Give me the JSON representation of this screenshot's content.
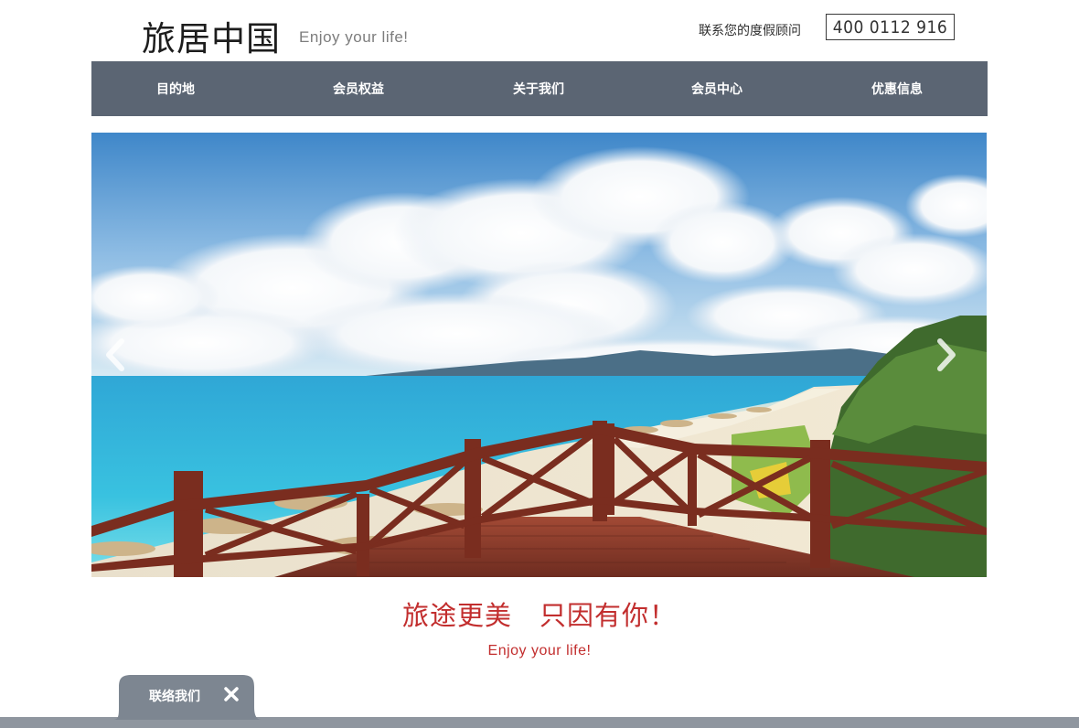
{
  "header": {
    "logo_cn": "旅居中国",
    "logo_en": "Enjoy your life!",
    "contact_label": "联系您的度假顾问",
    "phone": "400 0112 916"
  },
  "nav": {
    "items": [
      {
        "label": "目的地"
      },
      {
        "label": "会员权益"
      },
      {
        "label": "关于我们"
      },
      {
        "label": "会员中心"
      },
      {
        "label": "优惠信息"
      }
    ]
  },
  "hero": {
    "prev_icon": "chevron-left-icon",
    "next_icon": "chevron-right-icon"
  },
  "slogan": {
    "cn": "旅途更美　只因有你！",
    "en": "Enjoy your life!"
  },
  "contact_tab": {
    "label": "联络我们",
    "close_icon": "close-icon"
  },
  "colors": {
    "nav_bg": "#5b6573",
    "accent_red": "#c22e2e",
    "footer_bar": "#8f969f"
  }
}
